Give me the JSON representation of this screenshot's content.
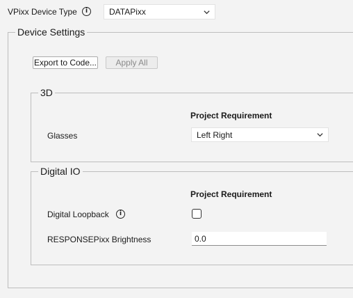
{
  "device_type": {
    "label": "VPixx Device Type",
    "info_icon": "info-icon",
    "selected": "DATAPixx"
  },
  "device_settings": {
    "title": "Device Settings",
    "export_button": "Export to Code...",
    "apply_all_button": "Apply All",
    "group_3d": {
      "title": "3D",
      "column_header": "Project Requirement",
      "glasses_label": "Glasses",
      "glasses_value": "Left Right"
    },
    "group_digital_io": {
      "title": "Digital IO",
      "column_header": "Project Requirement",
      "loopback_label": "Digital Loopback",
      "loopback_checked": false,
      "responsepixx_label": "RESPONSEPixx Brightness",
      "responsepixx_value": "0.0"
    }
  }
}
